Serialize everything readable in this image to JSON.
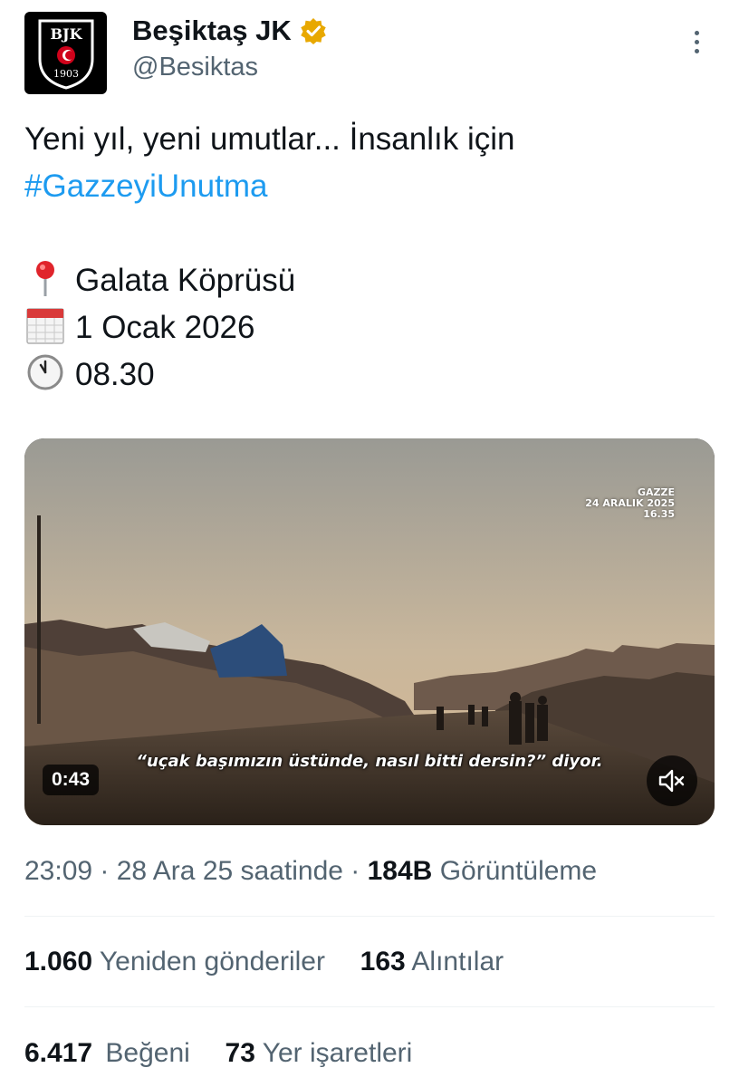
{
  "author": {
    "display_name": "Beşiktaş JK",
    "handle": "@Besiktas",
    "avatar_text_top": "BJK",
    "avatar_text_bottom": "1903",
    "verified_color": "#e8a800"
  },
  "tweet": {
    "line1": "Yeni yıl, yeni umutlar... İnsanlık için",
    "hashtag": "#GazzeyiUnutma",
    "location_icon": "pin-icon",
    "location": "Galata Köprüsü",
    "date_icon": "calendar-icon",
    "date": "1 Ocak 2026",
    "time_icon": "clock-icon",
    "time": "08.30"
  },
  "video": {
    "overlay_place": "GAZZE",
    "overlay_date": "24 ARALIK 2025",
    "overlay_time": "16.35",
    "subtitle": "“uçak başımızın üstünde, nasıl bitti dersin?” diyor.",
    "duration": "0:43",
    "mute_icon": "speaker-muted-icon"
  },
  "meta": {
    "time": "23:09",
    "separator": " · ",
    "date": "28 Ara 25 saatinde",
    "views_count": "184B",
    "views_label": "Görüntüleme"
  },
  "stats": {
    "reposts_count": "1.060",
    "reposts_label": "Yeniden gönderiler",
    "quotes_count": "163",
    "quotes_label": "Alıntılar",
    "likes_count": "6.417",
    "likes_label": "Beğeni",
    "bookmarks_count": "73",
    "bookmarks_label": "Yer işaretleri"
  },
  "colors": {
    "link": "#1d9bf0",
    "secondary_text": "#536471",
    "primary_text": "#0f1419"
  }
}
